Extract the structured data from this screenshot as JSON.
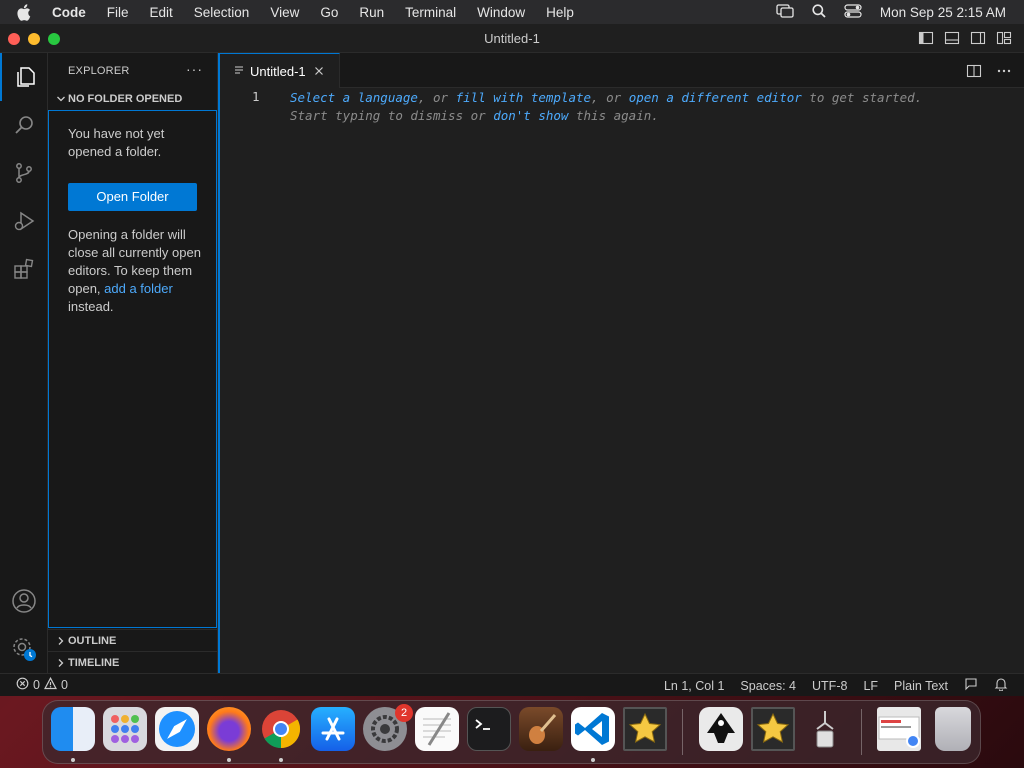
{
  "menubar": {
    "items": [
      "Code",
      "File",
      "Edit",
      "Selection",
      "View",
      "Go",
      "Run",
      "Terminal",
      "Window",
      "Help"
    ],
    "clock": "Mon Sep 25  2:15 AM"
  },
  "window": {
    "title": "Untitled-1"
  },
  "sidebar": {
    "header": "EXPLORER",
    "more": "···",
    "section_title": "NO FOLDER OPENED",
    "message": "You have not yet opened a folder.",
    "open_folder_label": "Open Folder",
    "note_before": "Opening a folder will close all currently open editors. To keep them open, ",
    "note_link": "add a folder",
    "note_after": " instead.",
    "outline_label": "OUTLINE",
    "timeline_label": "TIMELINE"
  },
  "editor": {
    "tab_label": "Untitled-1",
    "line_number": "1",
    "hint": {
      "select_language": "Select a language",
      "sep1": ", or ",
      "fill_template": "fill with template",
      "sep2": ", or ",
      "open_editor": "open a different editor",
      "tail1": " to get started.",
      "line2_start": "Start typing to dismiss or ",
      "dont_show": "don't show",
      "tail2": " this again."
    }
  },
  "statusbar": {
    "errors": "0",
    "warnings": "0",
    "position": "Ln 1, Col 1",
    "spaces": "Spaces: 4",
    "encoding": "UTF-8",
    "eol": "LF",
    "language": "Plain Text"
  },
  "dock": {
    "settings_badge": "2"
  },
  "colors": {
    "accent": "#0078d4",
    "link": "#4daafc",
    "editor_bg": "#1f1f1f",
    "sidebar_bg": "#181818"
  }
}
